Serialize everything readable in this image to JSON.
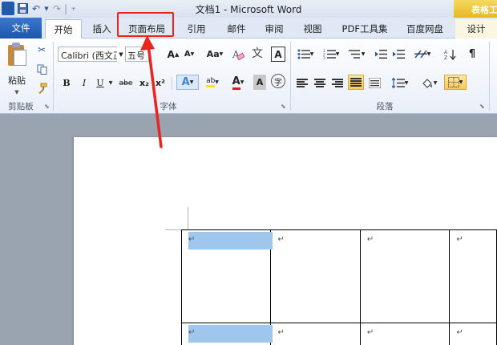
{
  "window": {
    "title": "文档1 - Microsoft Word",
    "context_tab_label": "表格工具",
    "qat": {
      "save_icon": "save-icon",
      "undo_glyph": "↶",
      "redo_glyph": "↷",
      "customize_glyph": "⫟"
    }
  },
  "tabs": {
    "file": "文件",
    "home": "开始",
    "insert": "插入",
    "page_layout": "页面布局",
    "references": "引用",
    "mailings": "邮件",
    "review": "审阅",
    "view": "视图",
    "pdf_tools": "PDF工具集",
    "baidu_disk": "百度网盘",
    "design": "设计"
  },
  "ribbon": {
    "clipboard": {
      "paste_label": "粘贴",
      "group_label": "剪贴板"
    },
    "font": {
      "font_name": "Calibri (西文正文)",
      "font_size": "五号",
      "grow_glyph": "A",
      "shrink_glyph": "A",
      "case_label": "Aa",
      "wen_glyph": "文",
      "char_border_glyph": "A",
      "bold": "B",
      "italic": "I",
      "underline": "U",
      "strike": "abe",
      "subscript": "x₂",
      "superscript": "x²",
      "effects_glyph": "A",
      "highlight_glyph": "ab",
      "color_glyph": "A",
      "charshade_glyph": "A",
      "enclose_glyph": "字",
      "group_label": "字体"
    },
    "paragraph": {
      "group_label": "段落"
    }
  },
  "document": {
    "cell_mark": "↵"
  },
  "colors": {
    "accent": "#2b579a",
    "file_tab": "#1d56ab",
    "annotation_red": "#e8251f",
    "cell_highlight": "#9fc6ec",
    "context_tab": "#f0c23a"
  }
}
